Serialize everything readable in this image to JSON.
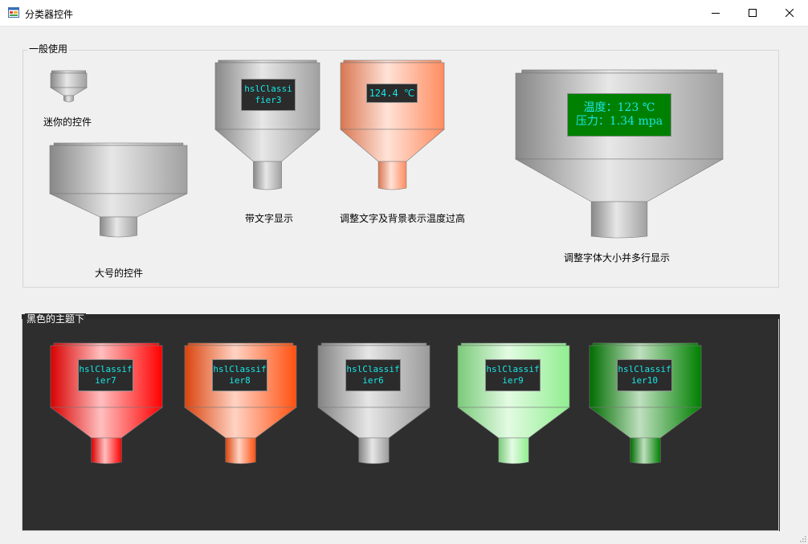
{
  "window": {
    "title": "分类器控件",
    "icon": "app-form-icon",
    "controls": [
      "minimize-icon",
      "maximize-icon",
      "close-icon"
    ]
  },
  "groups": [
    {
      "title": "一般使用",
      "background": "#f0f0f0"
    },
    {
      "title": "黑色的主题下",
      "background": "#2e2e2e"
    }
  ],
  "classifiers": [
    {
      "id": "mini",
      "color": "#a0a0a0",
      "lines": [],
      "caption": "迷你的控件"
    },
    {
      "id": "large",
      "color": "#a0a0a0",
      "lines": [],
      "caption": "大号的控件"
    },
    {
      "id": "text",
      "color": "#a0a0a0",
      "lines": [
        "hslClassi",
        "fier3"
      ],
      "textColor": "#19e6e6",
      "boxColor": "#2b2b2b",
      "caption": "带文字显示"
    },
    {
      "id": "temp",
      "color": "#ff8c60",
      "lines": [
        "124.4 ℃"
      ],
      "textColor": "#19e6e6",
      "boxColor": "#2b2b2b",
      "caption": "调整文字及背景表示温度过高"
    },
    {
      "id": "multi",
      "color": "#a0a0a0",
      "lines": [
        "温度：123 ℃",
        "压力：1.34 mpa"
      ],
      "textColor": "#19e6e6",
      "boxColor": "#008000",
      "caption": "调整字体大小并多行显示"
    },
    {
      "id": "dark-red",
      "color": "#ff0000",
      "lines": [
        "hslClassif",
        "ier7"
      ],
      "textColor": "#19e6e6",
      "boxColor": "#2b2b2b"
    },
    {
      "id": "dark-orange",
      "color": "#ff5010",
      "lines": [
        "hslClassif",
        "ier8"
      ],
      "textColor": "#19e6e6",
      "boxColor": "#2b2b2b"
    },
    {
      "id": "dark-gray",
      "color": "#9a9a9a",
      "lines": [
        "hslClassif",
        "ier6"
      ],
      "textColor": "#19e6e6",
      "boxColor": "#2b2b2b"
    },
    {
      "id": "dark-lightgreen",
      "color": "#90ee90",
      "lines": [
        "hslClassif",
        "ier9"
      ],
      "textColor": "#19e6e6",
      "boxColor": "#2b2b2b"
    },
    {
      "id": "dark-green",
      "color": "#008000",
      "lines": [
        "hslClassif",
        "ier10"
      ],
      "textColor": "#19e6e6",
      "boxColor": "#2b2b2b"
    }
  ]
}
